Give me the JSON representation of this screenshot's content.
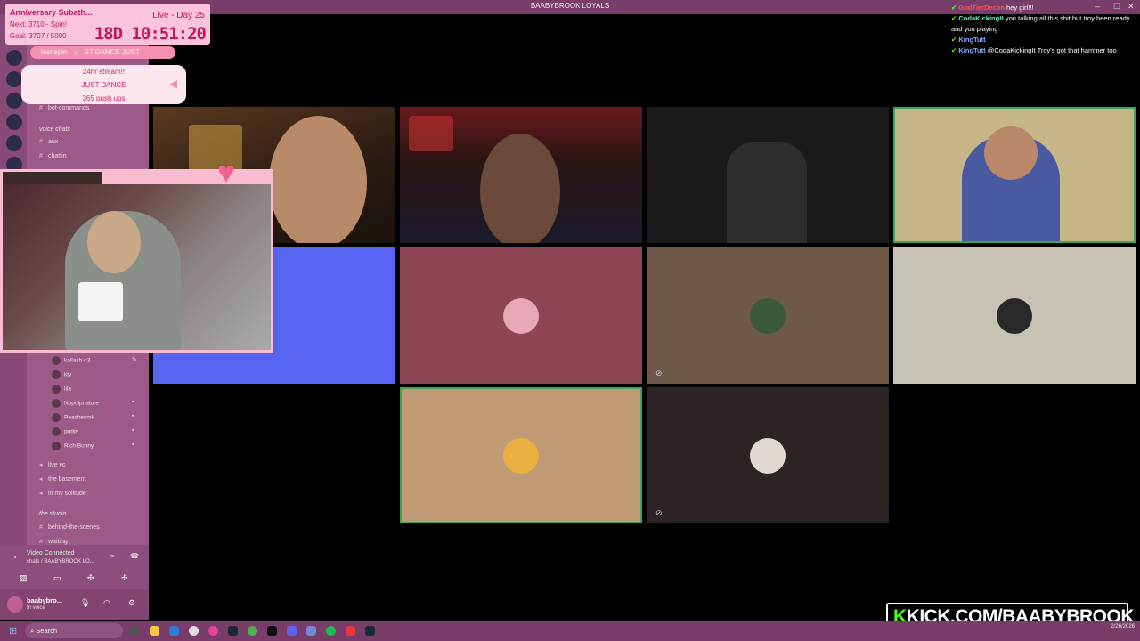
{
  "window": {
    "title": "BAABYBROOK LOYALS"
  },
  "overlay": {
    "goal_title": "Anniversary Subath...",
    "day": "Live - Day 25",
    "next": "Next: 3710 - Spin!",
    "goal": "Goal: 3707 / 5000",
    "timer": "18D 10:51:20",
    "last_spin_label": "last spin",
    "last_spin_value": "ST DANCE JUST",
    "wheel_items": [
      "24hr stream!!",
      "JUST DANCE",
      "365 push ups"
    ]
  },
  "sidebar": {
    "channels_top": [
      "bot-commands"
    ],
    "voice_category": "voice chats",
    "voice_channels": [
      "aux",
      "chattin"
    ],
    "voice_users": [
      "kailash <3",
      "ktv",
      "lila",
      "Nopulpnature",
      "Peachesmk",
      "porky",
      "Rich Bunny"
    ],
    "channels_mid": [
      "live vc",
      "the basement",
      "in my solitude"
    ],
    "studio_category": "the studio",
    "studio_channels": [
      "behind-the-scenes",
      "waiting"
    ],
    "voice_status": "Video Connected",
    "voice_channel_path": "chats / BAABYBROOK LO...",
    "user_name": "baabybro...",
    "user_status": "In voice"
  },
  "chat": [
    {
      "name": "GodTierDecon",
      "name_color": "#ff5252",
      "text": "hey girl!!!"
    },
    {
      "name": "CodaKickingIt",
      "name_color": "#69f0ae",
      "text": "you talking all this shit but troy been ready and you playing"
    },
    {
      "name": "KingTutt",
      "name_color": "#82b1ff",
      "text": ""
    },
    {
      "name": "KingTutt",
      "name_color": "#82b1ff",
      "text": "@CodaKickingIt Troy's got that hammer too"
    }
  ],
  "brand": {
    "kick_prefix": "K",
    "kick_text": "KICK.COM/BAABYBROOK"
  },
  "taskbar": {
    "search_placeholder": "Search",
    "time": "",
    "date": "2/26/2026"
  },
  "colors": {
    "accent": "#7a3d69",
    "blurple": "#5865f2",
    "kick_green": "#53fc18"
  }
}
